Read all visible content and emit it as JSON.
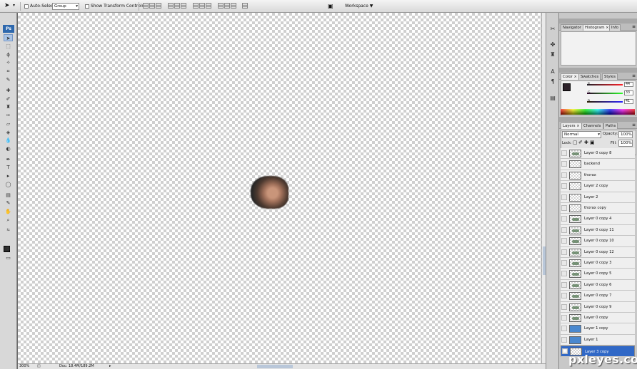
{
  "options_bar": {
    "auto_select_label": "Auto-Select:",
    "auto_select_value": "Group",
    "show_transform_label": "Show Transform Controls",
    "workspace_label": "Workspace ▼"
  },
  "toolbar": {
    "badge": "Ps"
  },
  "status_bar": {
    "zoom": "300%",
    "doc": "Doc: 18.4M/189.2M"
  },
  "navigator_panel": {
    "tabs": [
      "Navigator",
      "Histogram ×",
      "Info"
    ]
  },
  "color_panel": {
    "tabs": [
      "Color ×",
      "Swatches",
      "Styles"
    ],
    "channels": [
      {
        "label": "R",
        "value": "44"
      },
      {
        "label": "G",
        "value": "33"
      },
      {
        "label": "B",
        "value": "41"
      }
    ],
    "foreground_color": "#2c2129"
  },
  "layers_panel": {
    "tabs": [
      "Layers ×",
      "Channels",
      "Paths"
    ],
    "blend_mode": "Normal",
    "opacity_label": "Opacity:",
    "opacity_value": "100%",
    "lock_label": "Lock:",
    "fill_label": "Fill:",
    "fill_value": "100%",
    "layers": [
      "Layer 0 copy 8",
      "backend",
      "thorax",
      "Layer 2 copy",
      "Layer 2",
      "thorax copy",
      "Layer 0 copy 4",
      "Layer 0 copy 11",
      "Layer 0 copy 10",
      "Layer 0 copy 12",
      "Layer 0 copy 3",
      "Layer 0 copy 5",
      "Layer 0 copy 6",
      "Layer 0 copy 7",
      "Layer 0 copy 9",
      "Layer 0 copy",
      "Layer 1 copy",
      "Layer 1",
      "Layer 3 copy"
    ],
    "selected_layer": "Layer 3 copy"
  },
  "watermark": "pxleyes.com"
}
